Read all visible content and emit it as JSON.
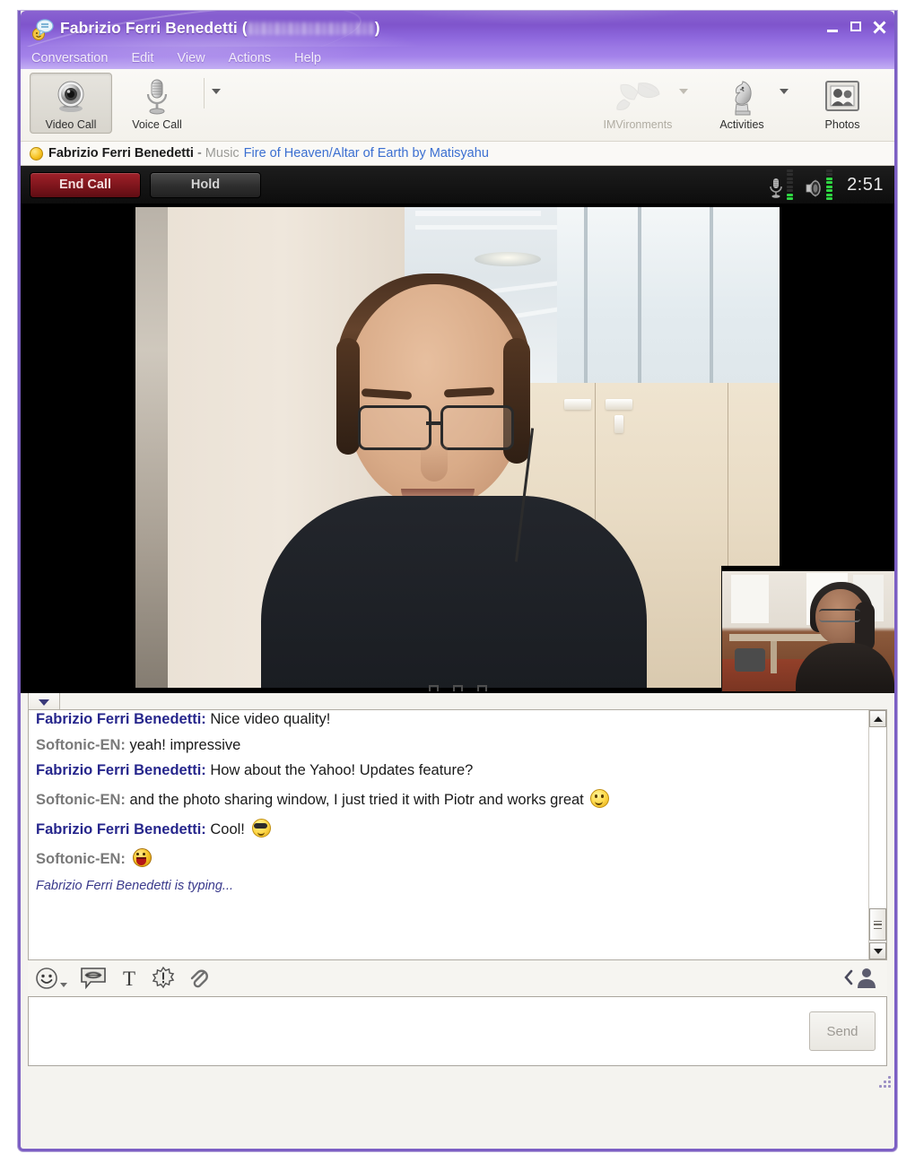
{
  "window": {
    "title_prefix": "Fabrizio Ferri Benedetti (",
    "title_suffix": ")",
    "redacted_note": "",
    "logo_icon": "yahoo-messenger-icon",
    "controls": {
      "minimize": "minimize-button",
      "maximize": "maximize-button",
      "close": "close-button"
    }
  },
  "menubar": {
    "items": [
      {
        "label": "Conversation"
      },
      {
        "label": "Edit"
      },
      {
        "label": "View"
      },
      {
        "label": "Actions"
      },
      {
        "label": "Help"
      }
    ]
  },
  "toolbar": {
    "left": [
      {
        "label": "Video Call",
        "icon": "webcam-icon",
        "state": "pressed",
        "caret": false
      },
      {
        "label": "Voice Call",
        "icon": "microphone-icon",
        "state": "normal",
        "caret": true
      }
    ],
    "right": [
      {
        "label": "IMVironments",
        "icon": "leaf-icon",
        "state": "disabled",
        "caret": true
      },
      {
        "label": "Activities",
        "icon": "chess-knight-icon",
        "state": "normal",
        "caret": true
      },
      {
        "label": "Photos",
        "icon": "photo-frame-icon",
        "state": "normal",
        "caret": false
      }
    ]
  },
  "status": {
    "presence_icon": "away-status-dot",
    "contact_name": "Fabrizio Ferri Benedetti",
    "separator": "-",
    "music_label": "Music",
    "track": "Fire of Heaven/Altar of Earth by Matisyahu"
  },
  "call": {
    "end_label": "End Call",
    "hold_label": "Hold",
    "mic_icon": "microphone-level-icon",
    "speaker_icon": "speaker-level-icon",
    "mic_level": 2,
    "speaker_level": 6,
    "meter_segments": 8,
    "timer": "2:51"
  },
  "video": {
    "main_view": "remote-video-feed",
    "pip_view": "local-video-pip"
  },
  "chat": {
    "collapse_icon": "chevron-down-icon",
    "messages": [
      {
        "who": "Fabrizio Ferri Benedetti:",
        "side": "them",
        "body": "Nice video quality!",
        "emoticon": ""
      },
      {
        "who": "Softonic-EN:",
        "side": "me",
        "body": "yeah! impressive",
        "emoticon": ""
      },
      {
        "who": "Fabrizio Ferri Benedetti:",
        "side": "them",
        "body": "How about the Yahoo! Updates feature?",
        "emoticon": ""
      },
      {
        "who": "Softonic-EN:",
        "side": "me",
        "body": "and the photo sharing window, I just tried it with Piotr and works great",
        "emoticon": "smile"
      },
      {
        "who": "Fabrizio Ferri Benedetti:",
        "side": "them",
        "body": "Cool!",
        "emoticon": "cool"
      },
      {
        "who": "Softonic-EN:",
        "side": "me",
        "body": "",
        "emoticon": "laugh"
      }
    ],
    "typing_notice": "Fabrizio Ferri Benedetti is typing...",
    "scrollbar": {
      "up_icon": "scroll-up-arrow-icon",
      "down_icon": "scroll-down-arrow-icon"
    }
  },
  "compose": {
    "tools": [
      {
        "icon": "emoticon-smiley-icon",
        "caret": true
      },
      {
        "icon": "audibles-speech-bubble-icon",
        "caret": false
      },
      {
        "icon": "font-format-text-icon",
        "caret": false
      },
      {
        "icon": "buzz-starburst-icon",
        "caret": false
      },
      {
        "icon": "attachment-paperclip-icon",
        "caret": false
      }
    ],
    "contact_icon": "contact-card-icon",
    "input_value": "",
    "input_placeholder": "",
    "send_label": "Send",
    "send_enabled": false
  },
  "footer": {
    "resize_grip_icon": "resize-grip-icon"
  },
  "colors": {
    "titlebar_purple": "#7f55cc",
    "window_border": "#7c5fc4",
    "end_call_red": "#7d151c",
    "link_blue": "#3b6fd1",
    "them_name_blue": "#26268c",
    "me_name_gray": "#7a7a7a",
    "status_dot_yellow": "#f7c324",
    "meter_green": "#2fd642"
  }
}
